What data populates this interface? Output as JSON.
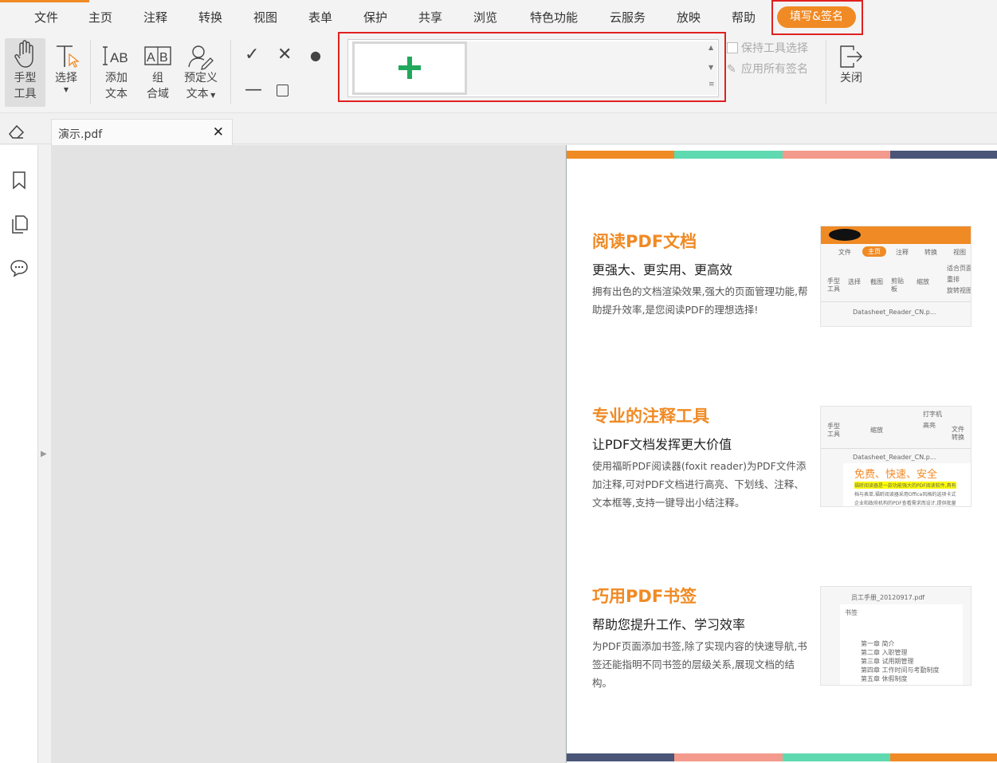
{
  "menu": {
    "items": [
      "文件",
      "主页",
      "注释",
      "转换",
      "视图",
      "表单",
      "保护",
      "共享",
      "浏览",
      "特色功能",
      "云服务",
      "放映",
      "帮助"
    ],
    "active": "填写&签名"
  },
  "ribbon": {
    "hand_tool": "手型\n工具",
    "select": "选择",
    "add_text": "添加\n文本",
    "comb_field": "组\n合域",
    "predefined_text": "预定义\n文本",
    "keep_tool_selected": "保持工具选择",
    "apply_all_signatures": "应用所有签名",
    "close": "关闭"
  },
  "tab": {
    "name": "演示.pdf",
    "close_glyph": "✕"
  },
  "page": {
    "band_colors": [
      "#f08a24",
      "#5fd9b0",
      "#f49a8c",
      "#4a5578"
    ],
    "sections": [
      {
        "title": "阅读PDF文档",
        "subtitle": "更强大、更实用、更高效",
        "body": "拥有出色的文档渲染效果,强大的页面管理功能,帮助提升效率,是您阅读PDF的理想选择!"
      },
      {
        "title": "专业的注释工具",
        "subtitle": "让PDF文档发挥更大价值",
        "body": "使用福昕PDF阅读器(foxit reader)为PDF文件添加注释,可对PDF文档进行高亮、下划线、注释、文本框等,支持一键导出小结注释。"
      },
      {
        "title": "巧用PDF书签",
        "subtitle": "帮助您提升工作、学习效率",
        "body": "为PDF页面添加书签,除了实现内容的快速导航,书签还能指明不同书签的层级关系,展现文档的结构。"
      }
    ],
    "thumb1": {
      "tabs": [
        "文件",
        "主页",
        "注释",
        "转换",
        "视图"
      ],
      "tools": [
        "手型\n工具",
        "选择",
        "截图",
        "剪贴\n板",
        "缩放"
      ],
      "side": [
        "适合页面",
        "重排",
        "旋转视图"
      ],
      "file": "Datasheet_Reader_CN.p..."
    },
    "thumb2": {
      "tools": [
        "手型\n工具",
        "缩放",
        "打字机",
        "高亮",
        "文件\n转换"
      ],
      "file": "Datasheet_Reader_CN.p...",
      "heading": "免费、快速、安全",
      "line1": "福昕阅读器是一款功能强大的PDF阅读软件,具有",
      "line2": "档与表单,福昕阅读器采用Office风格的选项卡式",
      "line3": "企业和政府机构的PDF查看需求而设计,提供批量"
    },
    "thumb3": {
      "file": "员工手册_20120917.pdf",
      "panel": "书签",
      "items": [
        "第一章  简介",
        "第二章  入职管理",
        "第三章  试用期管理",
        "第四章  工作时间与考勤制度",
        "第五章  休假制度"
      ]
    }
  }
}
